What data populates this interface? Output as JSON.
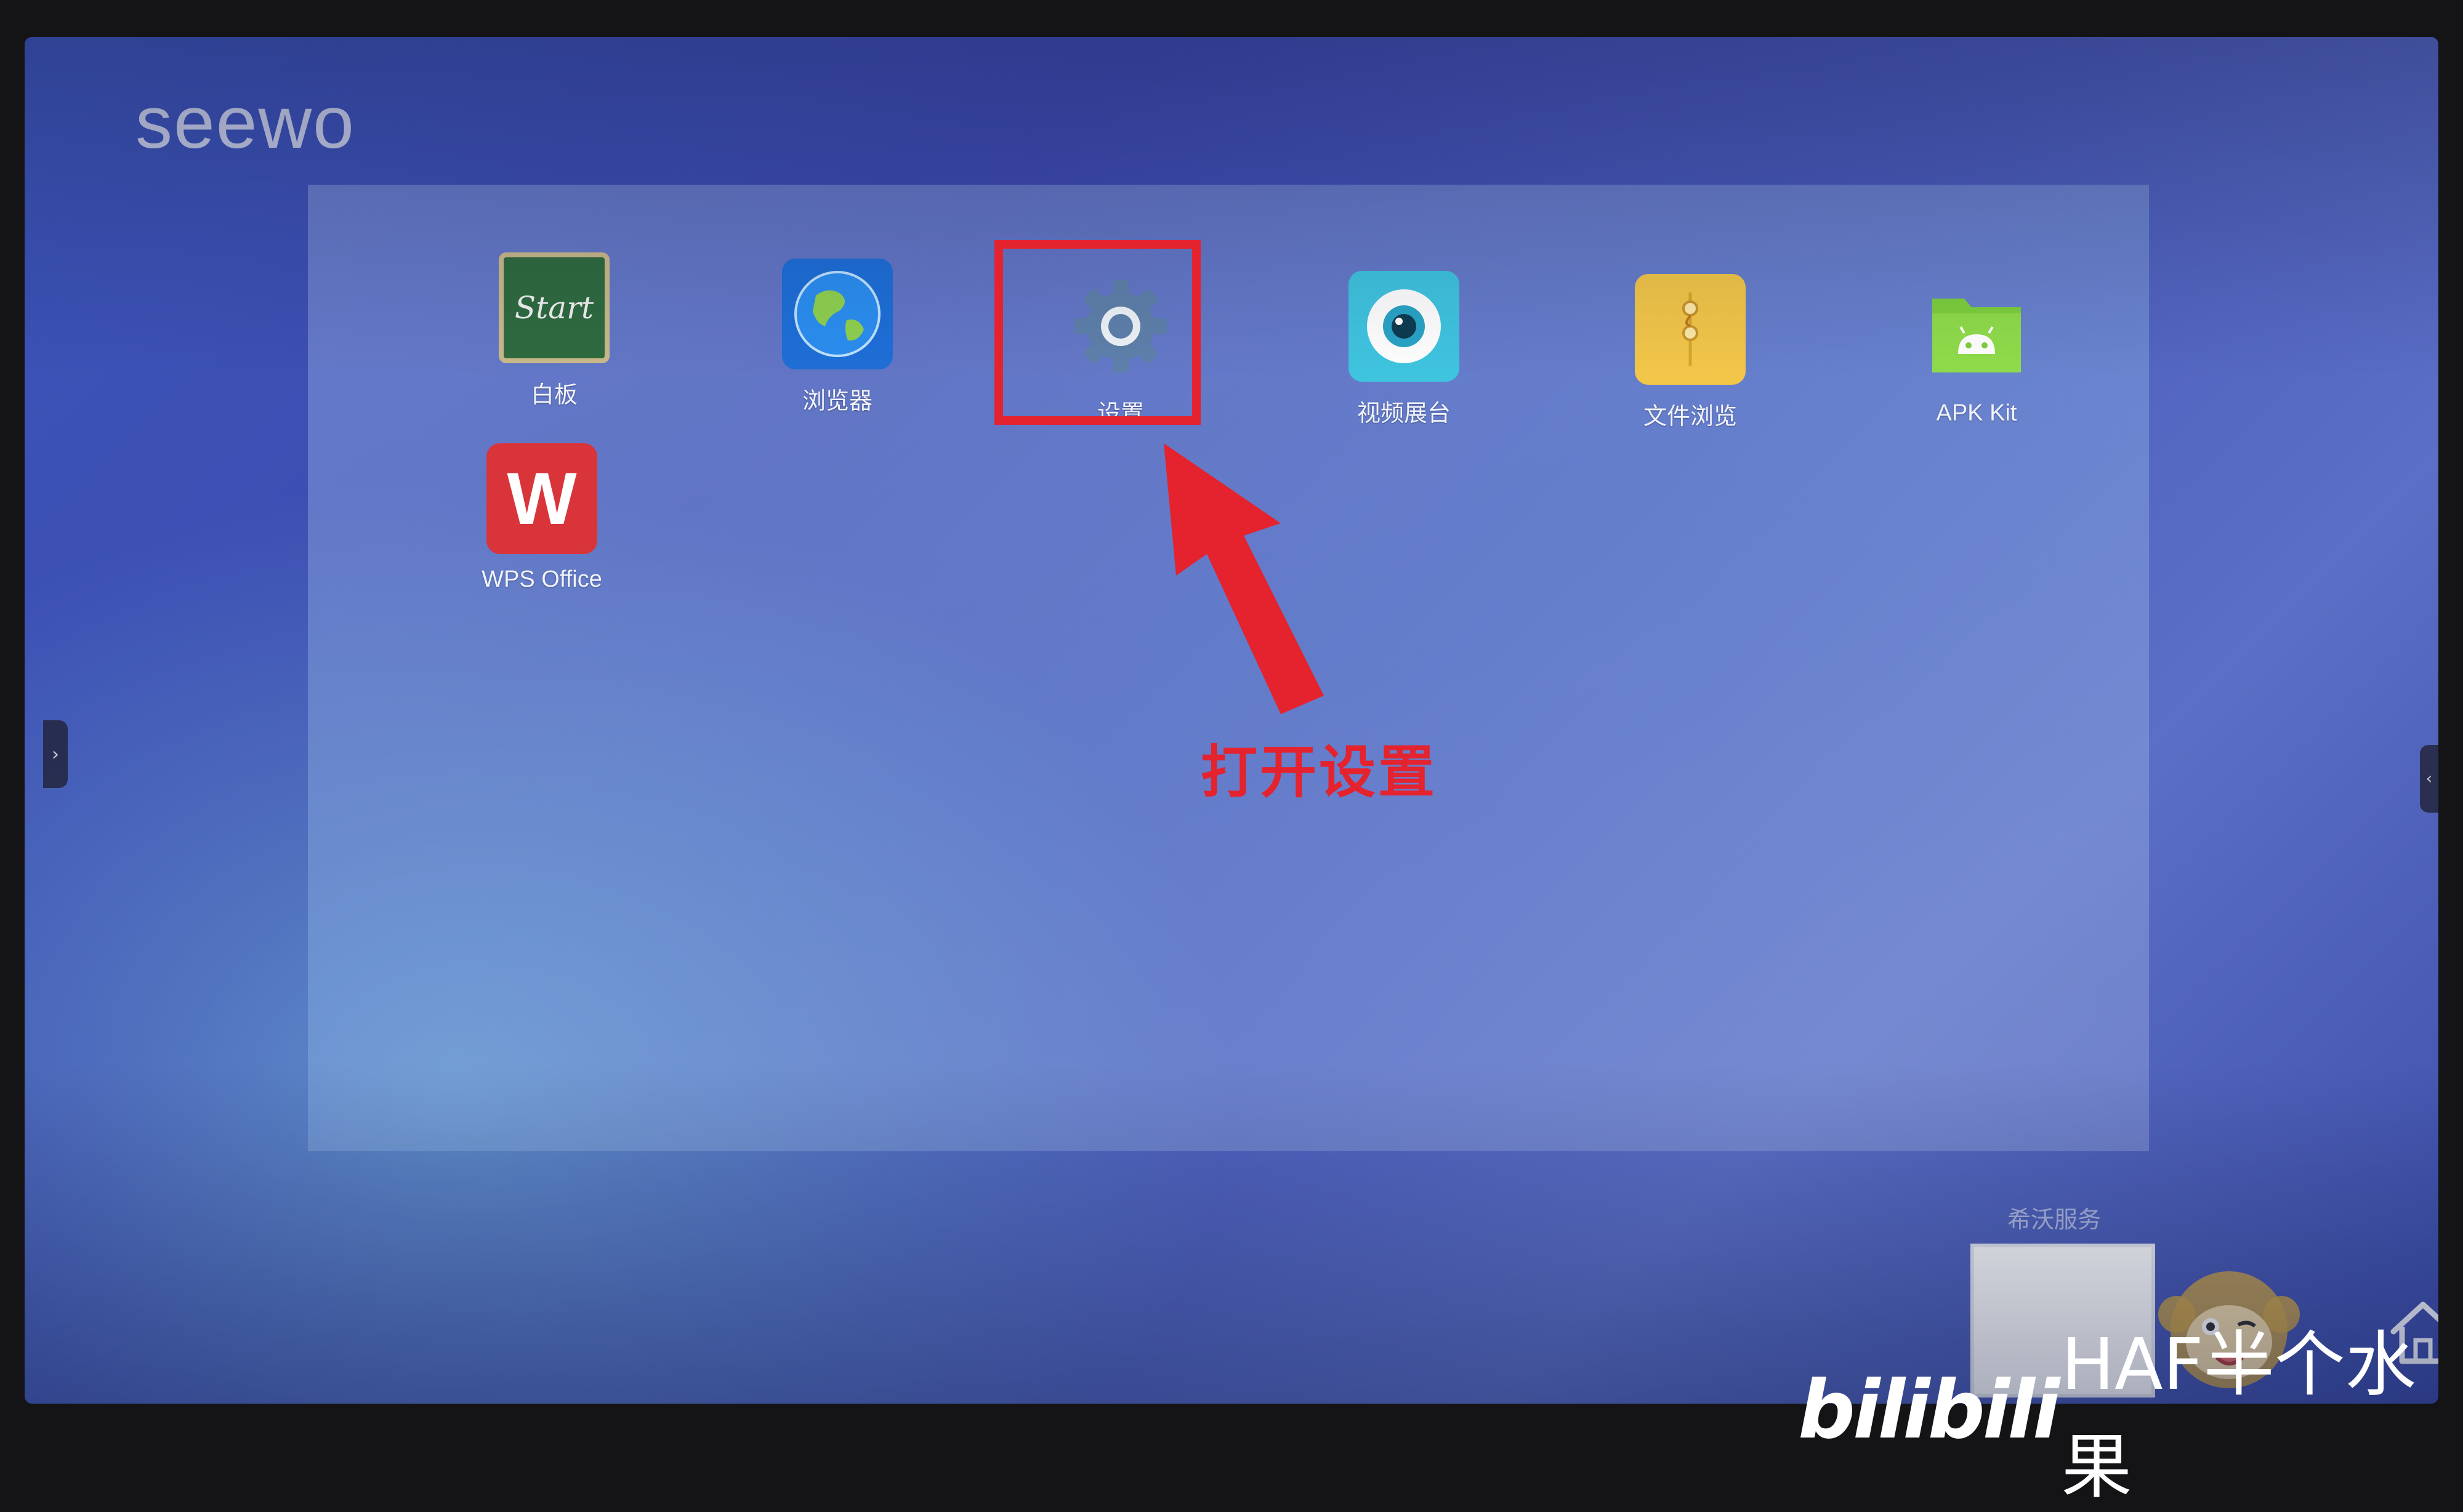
{
  "logo": {
    "text": "seewo"
  },
  "apps": [
    {
      "label": "白板",
      "icon": "whiteboard-icon",
      "icon_text": "Start"
    },
    {
      "label": "浏览器",
      "icon": "globe-icon"
    },
    {
      "label": "设置",
      "icon": "gear-icon"
    },
    {
      "label": "视频展台",
      "icon": "camera-icon"
    },
    {
      "label": "文件浏览",
      "icon": "envelope-folder-icon"
    },
    {
      "label": "APK Kit",
      "icon": "android-folder-icon"
    },
    {
      "label": "WPS Office",
      "icon": "wps-icon",
      "icon_text": "W"
    }
  ],
  "annotation": {
    "text": "打开设置",
    "color": "#e4232f",
    "target": "设置"
  },
  "side_tabs": {
    "left_glyph": "›",
    "right_glyph": "‹"
  },
  "service_widget": {
    "label": "希沃服务"
  },
  "home_button": {
    "icon": "home-icon"
  },
  "watermark": {
    "brand": "bilibili",
    "author": "HAF半个水果"
  },
  "colors": {
    "screen_blue": "#3d4bb0",
    "highlight_red": "#e4232f",
    "whiteboard_green": "#2e6b3f",
    "globe_blue": "#1e6fd8",
    "camera_cyan": "#3fc4e0",
    "folder_yellow": "#f2c649",
    "apk_green": "#7ccf3c",
    "wps_red": "#d9343a"
  }
}
